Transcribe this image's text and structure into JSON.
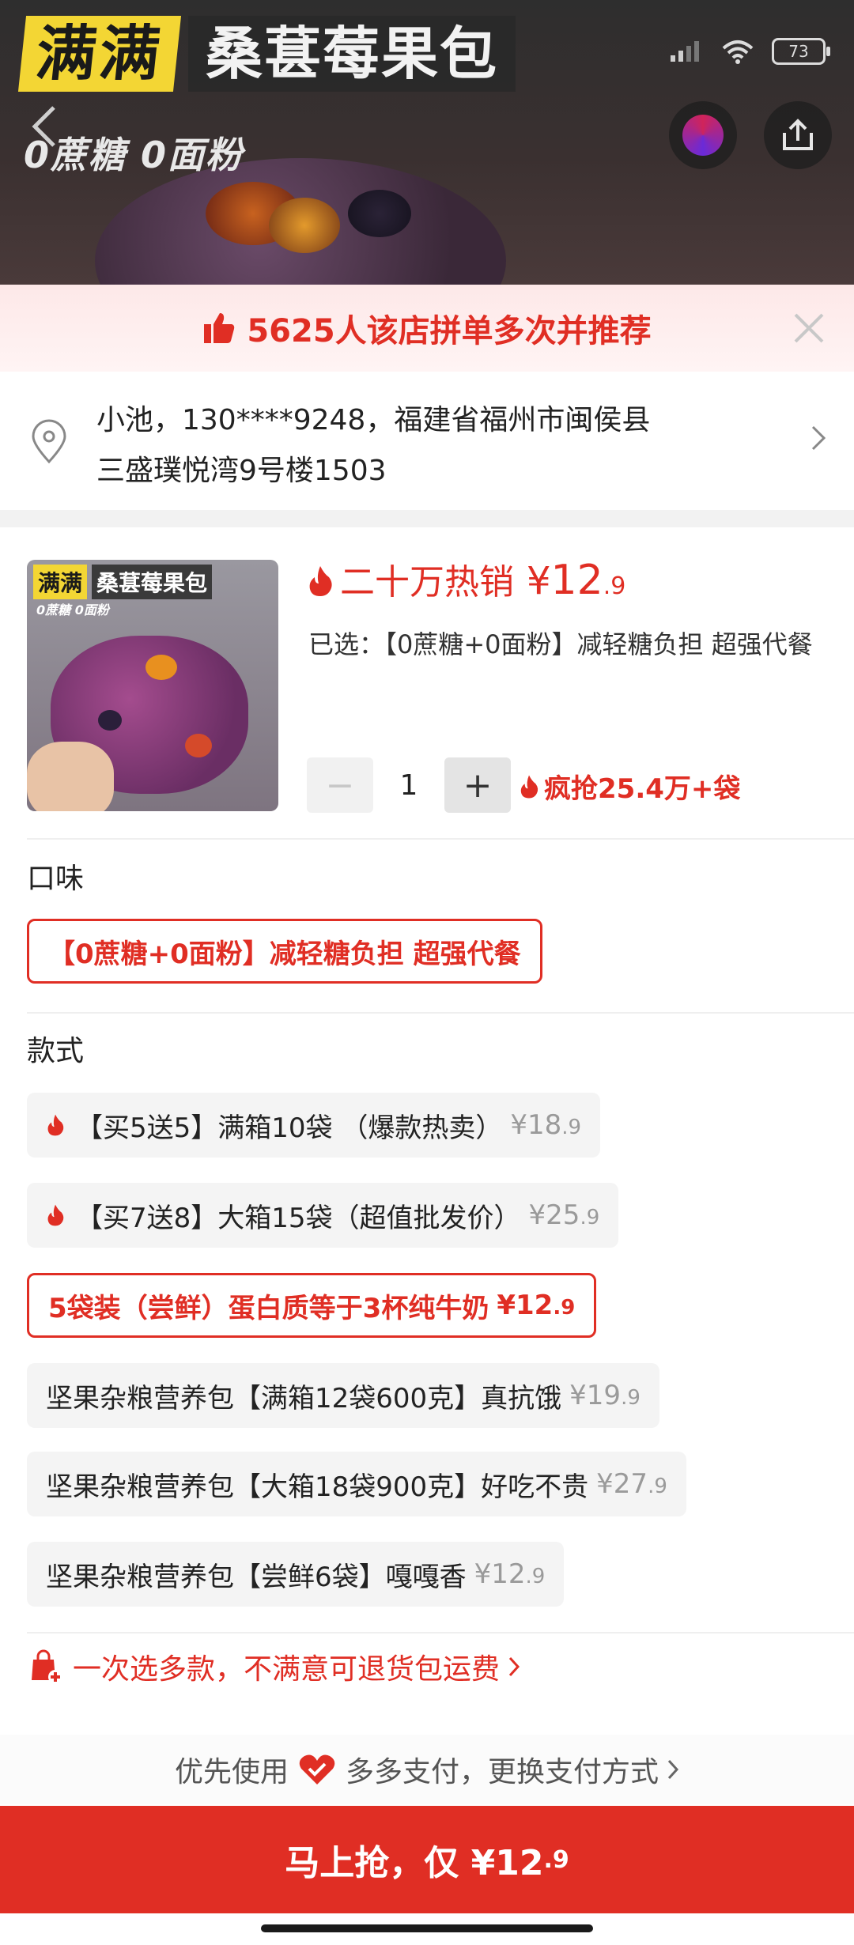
{
  "banner": {
    "title_yellow": "满满",
    "title_dark": "桑葚莓果包",
    "subtitle": "0蔗糖 0面粉",
    "battery": "73"
  },
  "recommend": {
    "text": "5625人该店拼单多次并推荐"
  },
  "address": {
    "line1": "小池，130****9248，福建省福州市闽侯县",
    "line2": "三盛璞悦湾9号楼1503"
  },
  "product": {
    "thumb_title_yellow": "满满",
    "thumb_title_dark": "桑葚莓果包",
    "thumb_sub": "0蔗糖 0面粉",
    "hot_label": "二十万热销",
    "price_symbol": "¥",
    "price_int": "12",
    "price_dec": ".9",
    "selected": "已选：【0蔗糖+0面粉】减轻糖负担 超强代餐",
    "quantity": "1",
    "minus": "−",
    "plus": "+",
    "rush": "疯抢25.4万+袋"
  },
  "flavor": {
    "label": "口味",
    "options": [
      {
        "name": "【0蔗糖+0面粉】减轻糖负担 超强代餐"
      }
    ]
  },
  "style": {
    "label": "款式",
    "options": [
      {
        "name": "【买5送5】满箱10袋 （爆款热卖）",
        "price_int": "¥18",
        "price_dec": ".9"
      },
      {
        "name": "【买7送8】大箱15袋（超值批发价）",
        "price_int": "¥25",
        "price_dec": ".9"
      },
      {
        "name": "5袋装（尝鲜）蛋白质等于3杯纯牛奶",
        "price_int": "¥12",
        "price_dec": ".9"
      },
      {
        "name": "坚果杂粮营养包【满箱12袋600克】真抗饿",
        "price_int": "¥19",
        "price_dec": ".9"
      },
      {
        "name": "坚果杂粮营养包【大箱18袋900克】好吃不贵",
        "price_int": "¥27",
        "price_dec": ".9"
      },
      {
        "name": "坚果杂粮营养包【尝鲜6袋】嘎嘎香",
        "price_int": "¥12",
        "price_dec": ".9"
      }
    ]
  },
  "promo": {
    "text": "一次选多款，不满意可退货包运费"
  },
  "payment": {
    "prefix": "优先使用",
    "text": "多多支付，更换支付方式"
  },
  "buy_button": {
    "label": "马上抢，仅 ¥12",
    "dec": ".9"
  },
  "colors": {
    "accent": "#e02e24",
    "banner_yellow": "#f3d634"
  }
}
